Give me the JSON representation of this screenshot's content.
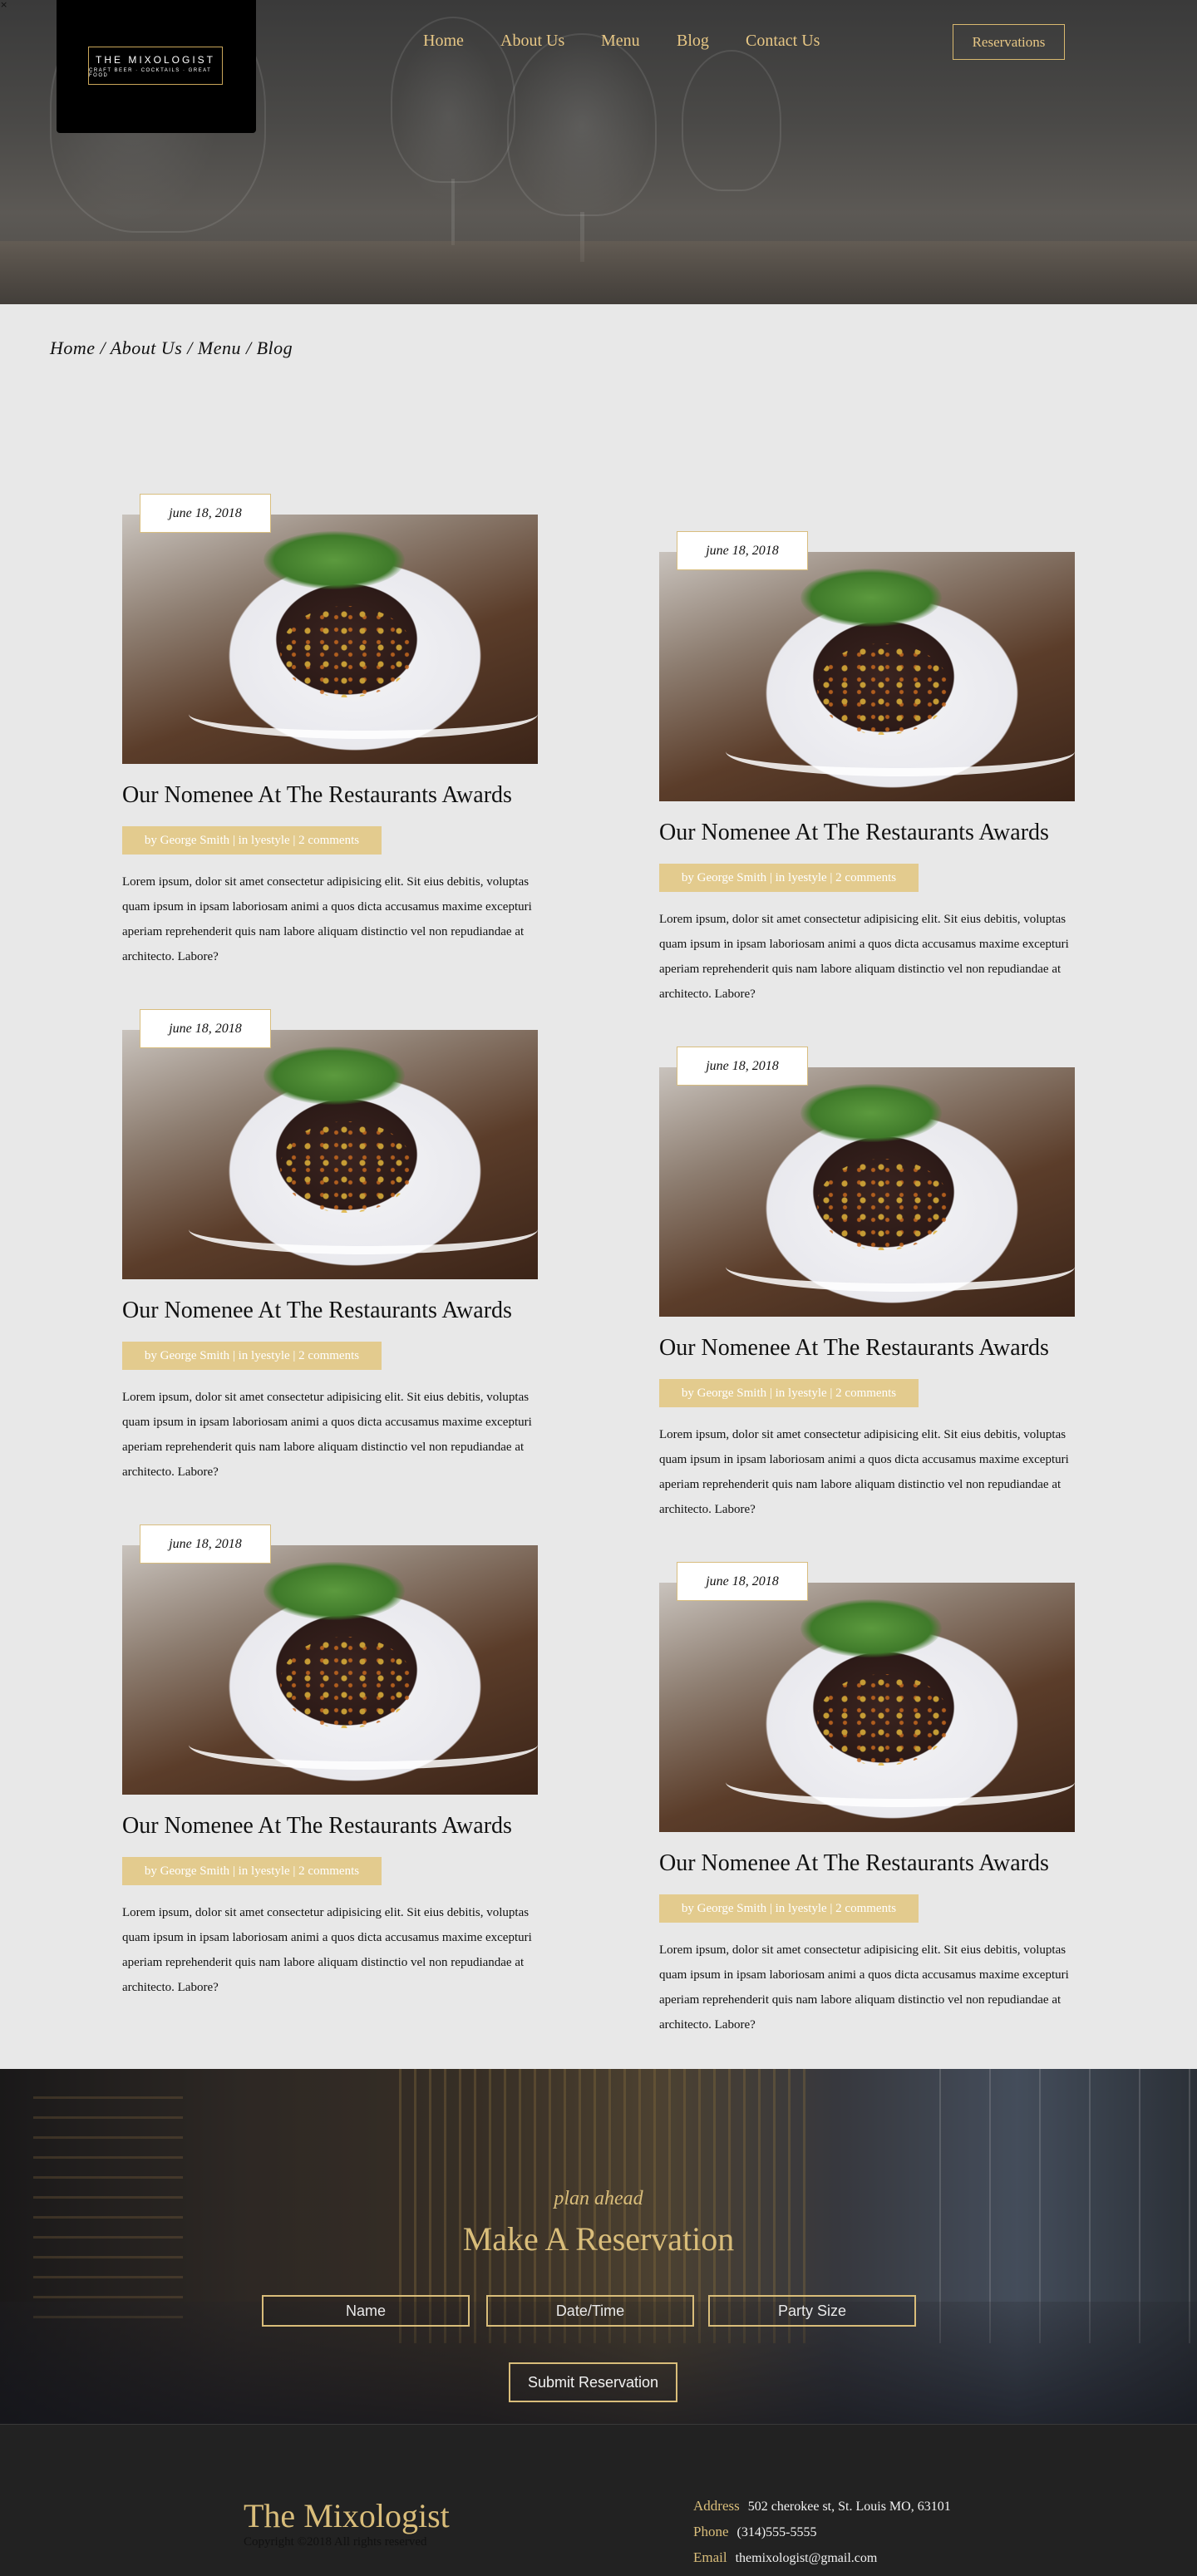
{
  "corner_glyph": "×",
  "brand": {
    "logo_title": "THE MIXOLOGIST",
    "logo_tagline": "CRAFT BEER · COCKTAILS · GREAT FOOD"
  },
  "nav": {
    "items": [
      {
        "label": "Home"
      },
      {
        "label": "About Us"
      },
      {
        "label": "Menu"
      },
      {
        "label": "Blog"
      },
      {
        "label": "Contact Us"
      }
    ],
    "reservations_label": "Reservations"
  },
  "breadcrumb": "Home / About Us / Menu / Blog",
  "posts": [
    {
      "date": "june 18, 2018",
      "title": "Our Nomenee At The Restaurants Awards",
      "meta": "by George Smith | in lyestyle | 2 comments",
      "excerpt": "Lorem ipsum, dolor sit amet consectetur adipisicing elit. Sit eius debitis, voluptas quam ipsum in ipsam laboriosam animi a quos dicta accusamus maxime excepturi aperiam reprehenderit quis nam labore aliquam distinctio vel non repudiandae at architecto. Labore?"
    },
    {
      "date": "june 18, 2018",
      "title": "Our Nomenee At The Restaurants Awards",
      "meta": "by George Smith | in lyestyle | 2 comments",
      "excerpt": "Lorem ipsum, dolor sit amet consectetur adipisicing elit. Sit eius debitis, voluptas quam ipsum in ipsam laboriosam animi a quos dicta accusamus maxime excepturi aperiam reprehenderit quis nam labore aliquam distinctio vel non repudiandae at architecto. Labore?"
    },
    {
      "date": "june 18, 2018",
      "title": "Our Nomenee At The Restaurants Awards",
      "meta": "by George Smith | in lyestyle | 2 comments",
      "excerpt": "Lorem ipsum, dolor sit amet consectetur adipisicing elit. Sit eius debitis, voluptas quam ipsum in ipsam laboriosam animi a quos dicta accusamus maxime excepturi aperiam reprehenderit quis nam labore aliquam distinctio vel non repudiandae at architecto. Labore?"
    },
    {
      "date": "june 18, 2018",
      "title": "Our Nomenee At The Restaurants Awards",
      "meta": "by George Smith | in lyestyle | 2 comments",
      "excerpt": "Lorem ipsum, dolor sit amet consectetur adipisicing elit. Sit eius debitis, voluptas quam ipsum in ipsam laboriosam animi a quos dicta accusamus maxime excepturi aperiam reprehenderit quis nam labore aliquam distinctio vel non repudiandae at architecto. Labore?"
    },
    {
      "date": "june 18, 2018",
      "title": "Our Nomenee At The Restaurants Awards",
      "meta": "by George Smith | in lyestyle | 2 comments",
      "excerpt": "Lorem ipsum, dolor sit amet consectetur adipisicing elit. Sit eius debitis, voluptas quam ipsum in ipsam laboriosam animi a quos dicta accusamus maxime excepturi aperiam reprehenderit quis nam labore aliquam distinctio vel non repudiandae at architecto. Labore?"
    },
    {
      "date": "june 18, 2018",
      "title": "Our Nomenee At The Restaurants Awards",
      "meta": "by George Smith | in lyestyle | 2 comments",
      "excerpt": "Lorem ipsum, dolor sit amet consectetur adipisicing elit. Sit eius debitis, voluptas quam ipsum in ipsam laboriosam animi a quos dicta accusamus maxime excepturi aperiam reprehenderit quis nam labore aliquam distinctio vel non repudiandae at architecto. Labore?"
    }
  ],
  "reservation": {
    "kicker": "plan ahead",
    "title": "Make A Reservation",
    "fields": [
      "Name",
      "Date/Time",
      "Party Size"
    ],
    "submit_label": "Submit Reservation"
  },
  "footer": {
    "brand": "The Mixologist",
    "copyright": "Copyright ©2018 All rights reserved",
    "contacts": [
      {
        "label": "Address",
        "value": "502 cherokee st, St. Louis MO, 63101"
      },
      {
        "label": "Phone",
        "value": "(314)555-5555"
      },
      {
        "label": "Email",
        "value": "themixologist@gmail.com"
      }
    ]
  },
  "colors": {
    "accent_gold": "#d9bd7a",
    "meta_bar": "#e3cb8e",
    "page_bg": "#e8e8e8",
    "footer_bg": "#222222"
  }
}
